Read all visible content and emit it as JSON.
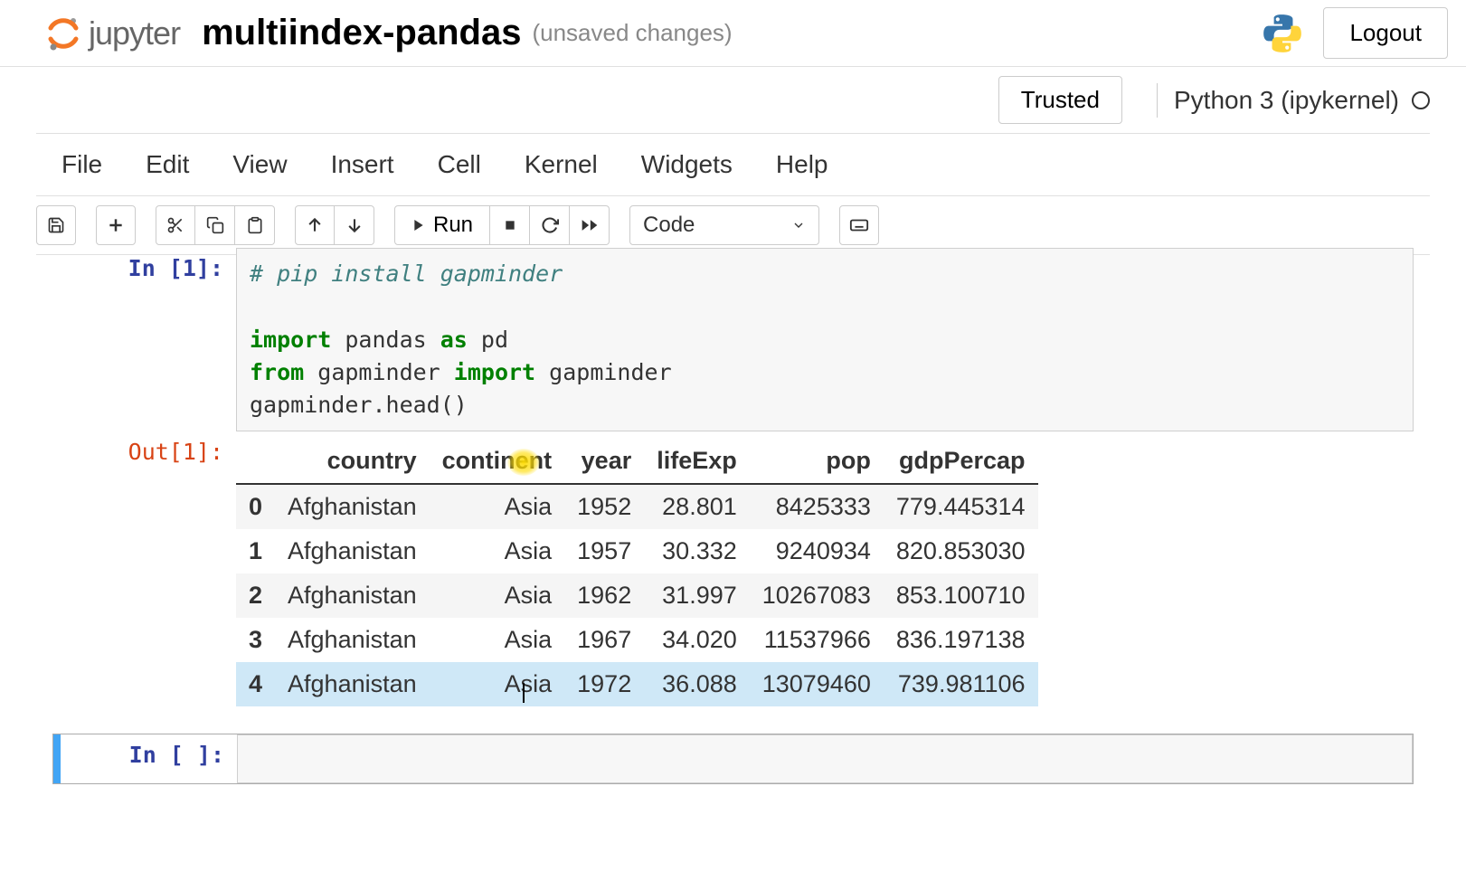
{
  "header": {
    "jupyter_word": "jupyter",
    "title": "multiindex-pandas",
    "save_status": "(unsaved changes)",
    "logout": "Logout"
  },
  "status": {
    "trusted": "Trusted",
    "kernel": "Python 3 (ipykernel)"
  },
  "menu": [
    "File",
    "Edit",
    "View",
    "Insert",
    "Cell",
    "Kernel",
    "Widgets",
    "Help"
  ],
  "toolbar": {
    "run_label": "Run",
    "cell_type": "Code"
  },
  "cell1": {
    "in_prompt": "In [1]:",
    "out_prompt": "Out[1]:",
    "code_comment": "# pip install gapminder",
    "code_line1_kw1": "import",
    "code_line1_t1": " pandas ",
    "code_line1_kw2": "as",
    "code_line1_t2": " pd",
    "code_line2_kw1": "from",
    "code_line2_t1": " gapminder ",
    "code_line2_kw2": "import",
    "code_line2_t2": " gapminder",
    "code_line3": "gapminder.head()"
  },
  "dataframe": {
    "columns": [
      "",
      "country",
      "continent",
      "year",
      "lifeExp",
      "pop",
      "gdpPercap"
    ],
    "rows": [
      {
        "idx": "0",
        "country": "Afghanistan",
        "continent": "Asia",
        "year": "1952",
        "lifeExp": "28.801",
        "pop": "8425333",
        "gdpPercap": "779.445314"
      },
      {
        "idx": "1",
        "country": "Afghanistan",
        "continent": "Asia",
        "year": "1957",
        "lifeExp": "30.332",
        "pop": "9240934",
        "gdpPercap": "820.853030"
      },
      {
        "idx": "2",
        "country": "Afghanistan",
        "continent": "Asia",
        "year": "1962",
        "lifeExp": "31.997",
        "pop": "10267083",
        "gdpPercap": "853.100710"
      },
      {
        "idx": "3",
        "country": "Afghanistan",
        "continent": "Asia",
        "year": "1967",
        "lifeExp": "34.020",
        "pop": "11537966",
        "gdpPercap": "836.197138"
      },
      {
        "idx": "4",
        "country": "Afghanistan",
        "continent": "Asia",
        "year": "1972",
        "lifeExp": "36.088",
        "pop": "13079460",
        "gdpPercap": "739.981106"
      }
    ]
  },
  "cell2": {
    "in_prompt": "In [ ]:"
  }
}
